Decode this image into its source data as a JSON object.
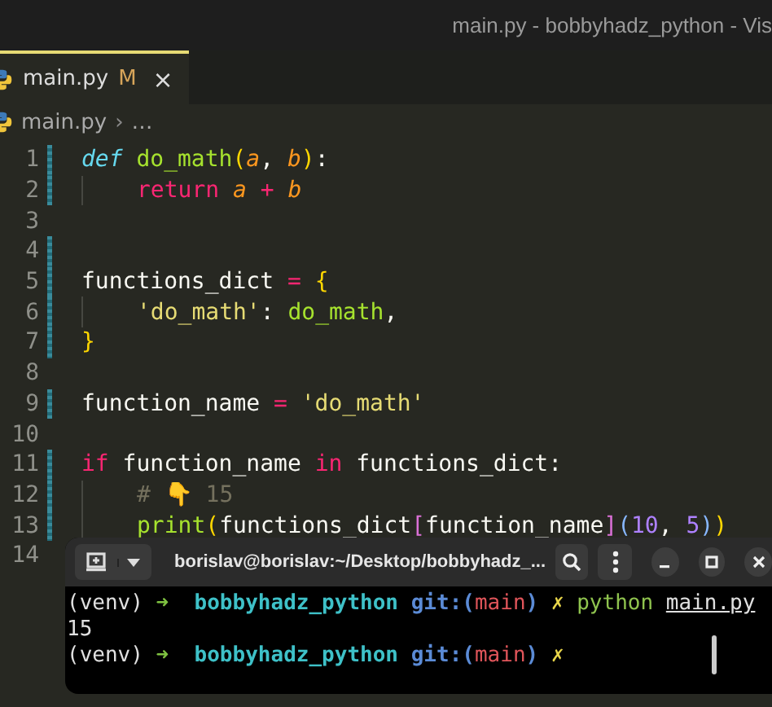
{
  "window": {
    "title": "main.py - bobbyhadz_python - Vis"
  },
  "tabs": [
    {
      "label": "main.py",
      "badge": "M",
      "close": "×",
      "selected": true
    }
  ],
  "breadcrumb": {
    "file": "main.py",
    "separator": "›",
    "rest": "…"
  },
  "editor": {
    "lines": [
      {
        "number": "1",
        "modified": true,
        "indented": false,
        "tokens": [
          {
            "text": "def ",
            "kind": "storage"
          },
          {
            "text": "do_math",
            "kind": "fn"
          },
          {
            "text": "(",
            "kind": "bracket1"
          },
          {
            "text": "a",
            "kind": "param"
          },
          {
            "text": ", ",
            "kind": "plain"
          },
          {
            "text": "b",
            "kind": "param"
          },
          {
            "text": ")",
            "kind": "bracket1"
          },
          {
            "text": ":",
            "kind": "plain"
          }
        ]
      },
      {
        "number": "2",
        "modified": true,
        "indented": true,
        "tokens": [
          {
            "text": "return ",
            "kind": "keyword"
          },
          {
            "text": "a",
            "kind": "param"
          },
          {
            "text": " + ",
            "kind": "keyword"
          },
          {
            "text": "b",
            "kind": "param"
          }
        ]
      },
      {
        "number": "3",
        "modified": false
      },
      {
        "number": "4",
        "modified": true
      },
      {
        "number": "5",
        "modified": true,
        "indented": false,
        "tokens": [
          {
            "text": "functions_dict",
            "kind": "plain"
          },
          {
            "text": " = ",
            "kind": "keyword"
          },
          {
            "text": "{",
            "kind": "bracket1"
          }
        ]
      },
      {
        "number": "6",
        "modified": true,
        "indented": true,
        "tokens": [
          {
            "text": "'do_math'",
            "kind": "string"
          },
          {
            "text": ": ",
            "kind": "plain"
          },
          {
            "text": "do_math",
            "kind": "fn"
          },
          {
            "text": ",",
            "kind": "plain"
          }
        ]
      },
      {
        "number": "7",
        "modified": true,
        "indented": false,
        "tokens": [
          {
            "text": "}",
            "kind": "bracket1"
          }
        ]
      },
      {
        "number": "8",
        "modified": false
      },
      {
        "number": "9",
        "modified": true,
        "indented": false,
        "tokens": [
          {
            "text": "function_name",
            "kind": "plain"
          },
          {
            "text": " = ",
            "kind": "keyword"
          },
          {
            "text": "'do_math'",
            "kind": "string"
          }
        ]
      },
      {
        "number": "10",
        "modified": false
      },
      {
        "number": "11",
        "modified": true,
        "indented": false,
        "tokens": [
          {
            "text": "if ",
            "kind": "keyword"
          },
          {
            "text": "function_name ",
            "kind": "plain"
          },
          {
            "text": "in ",
            "kind": "keyword"
          },
          {
            "text": "functions_dict:",
            "kind": "plain"
          }
        ]
      },
      {
        "number": "12",
        "modified": true,
        "indented": true,
        "tokens": [
          {
            "text": "# 👇 15",
            "kind": "comment"
          }
        ]
      },
      {
        "number": "13",
        "modified": true,
        "indented": true,
        "tokens": [
          {
            "text": "print",
            "kind": "fn"
          },
          {
            "text": "(",
            "kind": "bracket1"
          },
          {
            "text": "functions_dict",
            "kind": "plain"
          },
          {
            "text": "[",
            "kind": "bracket2"
          },
          {
            "text": "function_name",
            "kind": "plain"
          },
          {
            "text": "]",
            "kind": "bracket2"
          },
          {
            "text": "(",
            "kind": "bracket3"
          },
          {
            "text": "10",
            "kind": "number"
          },
          {
            "text": ", ",
            "kind": "plain"
          },
          {
            "text": "5",
            "kind": "number"
          },
          {
            "text": ")",
            "kind": "bracket3"
          },
          {
            "text": ")",
            "kind": "bracket1"
          }
        ]
      },
      {
        "number": "14",
        "modified": false
      }
    ]
  },
  "terminal": {
    "title": "borislav@borislav:~/Desktop/bobbyhadz_...",
    "lines": [
      [
        {
          "text": "(venv) ",
          "kind": "plain"
        },
        {
          "text": "➜  ",
          "kind": "arrow"
        },
        {
          "text": "bobbyhadz_python",
          "kind": "dir"
        },
        {
          "text": " git:(",
          "kind": "git"
        },
        {
          "text": "main",
          "kind": "branch"
        },
        {
          "text": ")",
          "kind": "git"
        },
        {
          "text": " ✗",
          "kind": "dirty"
        },
        {
          "text": " python ",
          "kind": "cmd"
        },
        {
          "text": "main.py",
          "kind": "arg"
        }
      ],
      [
        {
          "text": "15",
          "kind": "plain"
        }
      ],
      [
        {
          "text": "(venv) ",
          "kind": "plain"
        },
        {
          "text": "➜  ",
          "kind": "arrow"
        },
        {
          "text": "bobbyhadz_python",
          "kind": "dir"
        },
        {
          "text": " git:(",
          "kind": "git"
        },
        {
          "text": "main",
          "kind": "branch"
        },
        {
          "text": ")",
          "kind": "git"
        },
        {
          "text": " ✗",
          "kind": "dirty"
        }
      ]
    ]
  }
}
